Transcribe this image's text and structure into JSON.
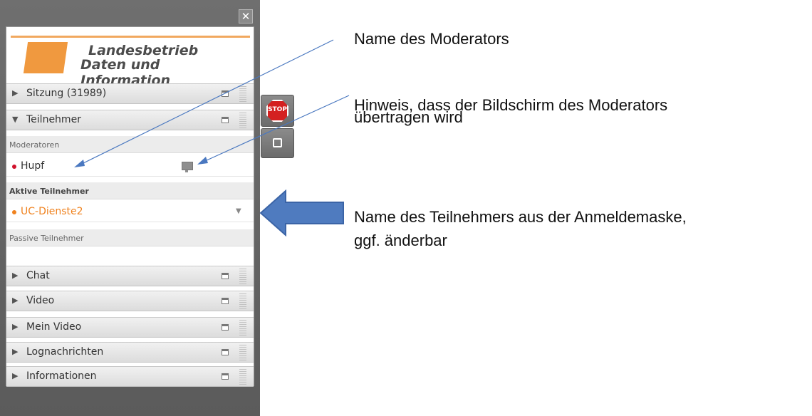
{
  "window": {
    "close_glyph": "✕"
  },
  "logo": {
    "line1": "Landesbetrieb",
    "line2": "Daten und Information"
  },
  "sections": {
    "sitzung": "Sitzung (31989)",
    "teilnehmer": "Teilnehmer",
    "chat": "Chat",
    "video": "Video",
    "mein_video": "Mein Video",
    "lognachrichten": "Lognachrichten",
    "informationen": "Informationen"
  },
  "participants": {
    "moderators_header": "Moderatoren",
    "moderator_name": "Hupf",
    "active_header": "Aktive Teilnehmer",
    "active_name": "UC-Dienste2",
    "passive_header": "Passive Teilnehmer"
  },
  "buttons": {
    "stop_label": "STOP"
  },
  "annotations": {
    "moderator_name": "Name des Moderators",
    "screen_hint_line1": "Hinweis, dass der Bildschirm des Moderators",
    "screen_hint_line2": "übertragen wird",
    "participant_name_line1": "Name des Teilnehmers aus der Anmeldemaske,",
    "participant_name_line2": "ggf. änderbar"
  },
  "colors": {
    "moderator_dot": "#d0112b",
    "active_participant": "#f0821e",
    "arrow_fill": "#4f7bbf",
    "leader_line": "#4a78c0"
  },
  "icons": {
    "expanded": "▼",
    "collapsed": "▶",
    "dropdown": "▼"
  }
}
